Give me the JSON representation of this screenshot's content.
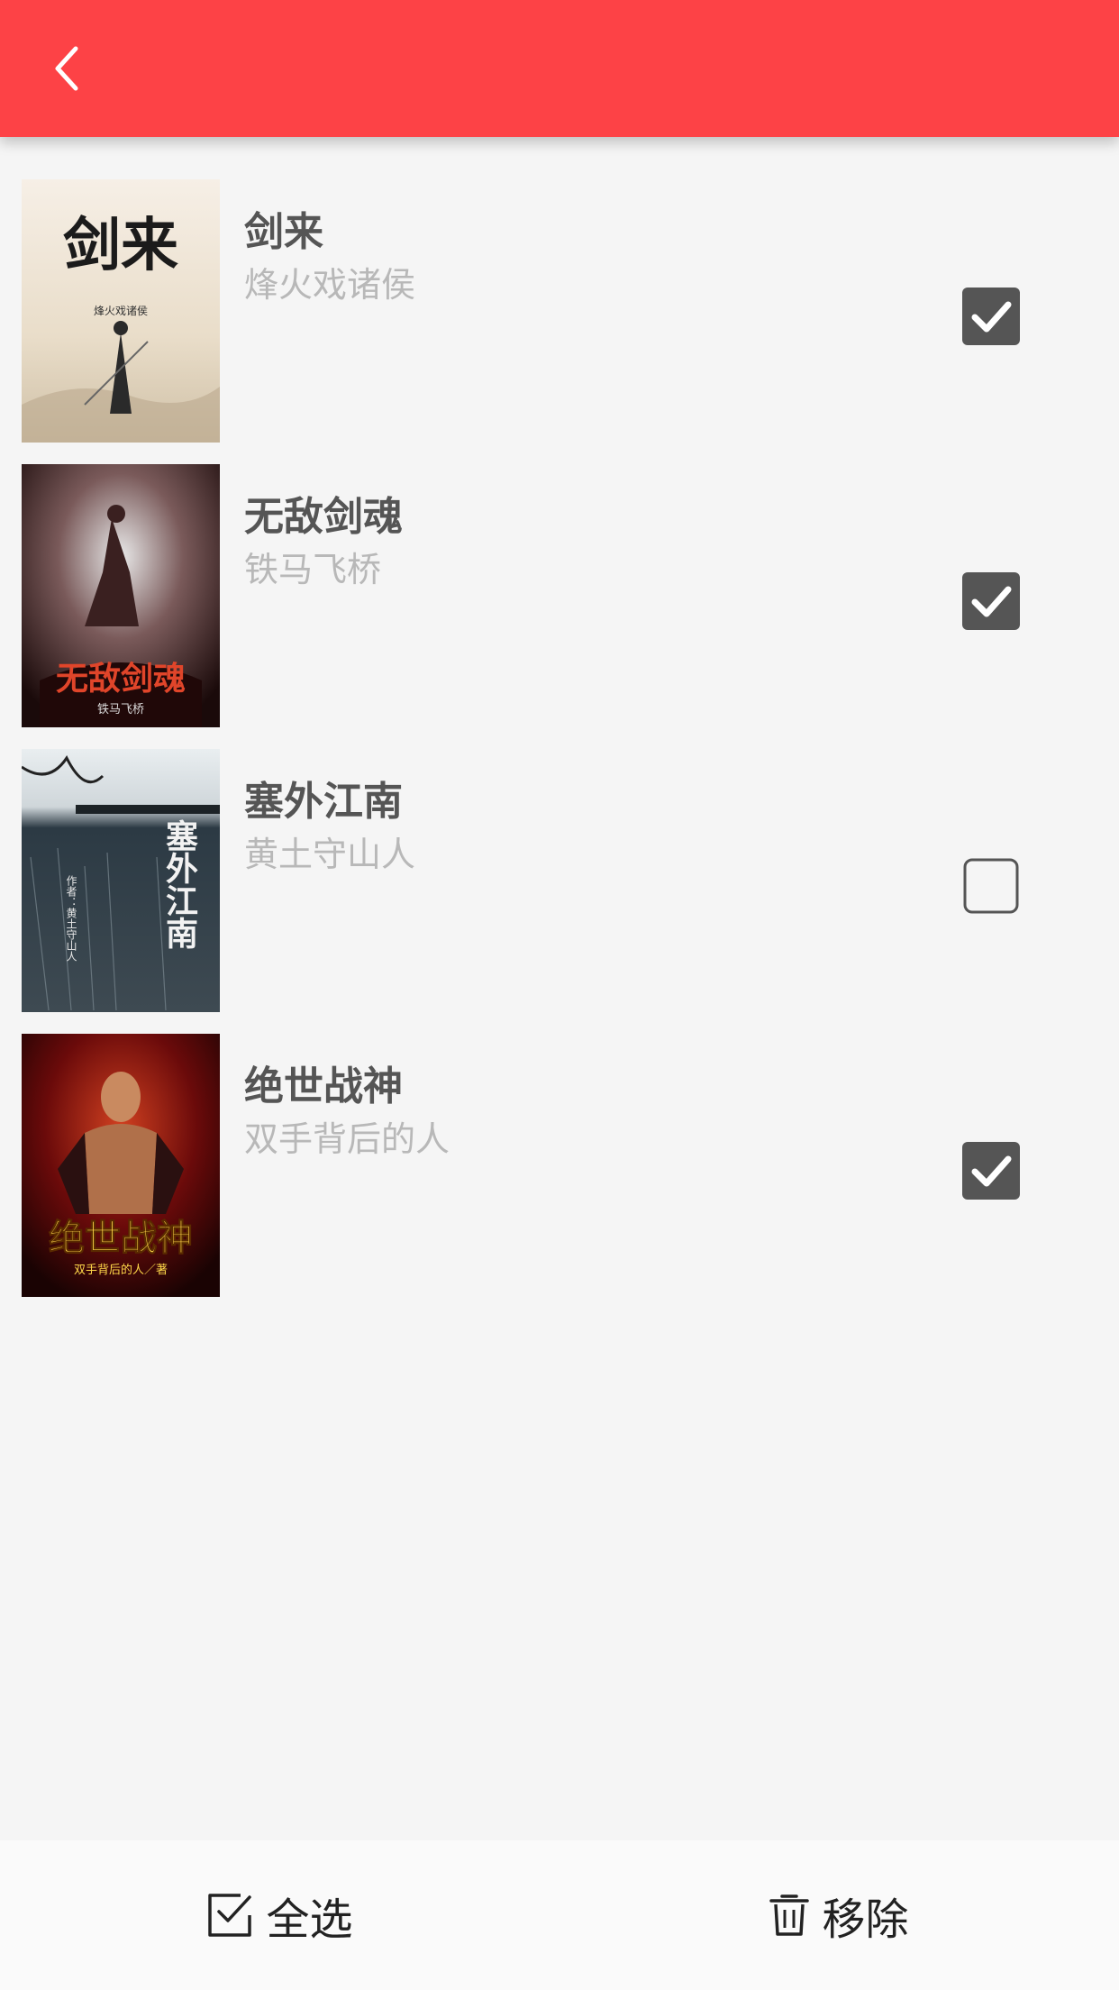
{
  "header": {
    "back_icon": "chevron-left-icon",
    "color": "#fd4246"
  },
  "books": [
    {
      "title": "剑来",
      "author": "烽火戏诸侯",
      "checked": true,
      "cover_text": "剑来",
      "cover_author": "烽火戏诸侯"
    },
    {
      "title": "无敌剑魂",
      "author": "铁马飞桥",
      "checked": true,
      "cover_text": "无敌剑魂",
      "cover_author": "铁马飞桥"
    },
    {
      "title": "塞外江南",
      "author": "黄土守山人",
      "checked": false,
      "cover_text": "塞外江南",
      "cover_author": "作者：黄土守山人"
    },
    {
      "title": "绝世战神",
      "author": "双手背后的人",
      "checked": true,
      "cover_text": "绝世战神",
      "cover_author": "双手背后的人／著"
    }
  ],
  "footer": {
    "select_all_label": "全选",
    "select_all_icon": "select-all-icon",
    "remove_label": "移除",
    "remove_icon": "trash-icon"
  }
}
